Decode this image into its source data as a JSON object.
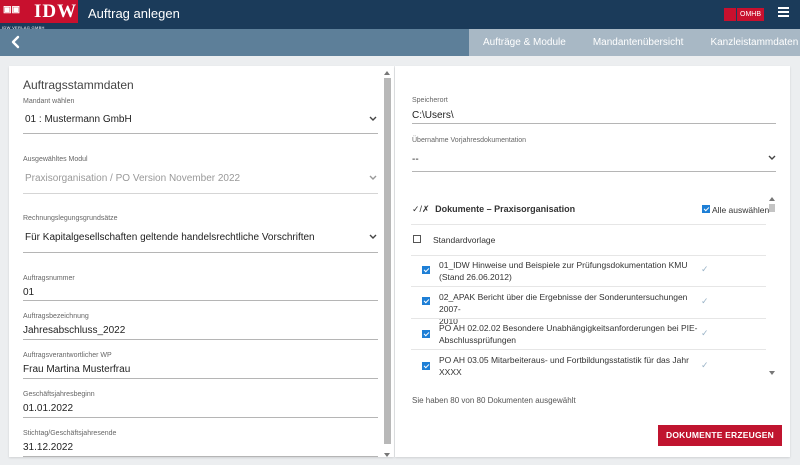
{
  "app": {
    "logo_text": "IDW",
    "logo_sub": "IDW VERLAG GMBH",
    "title": "Auftrag anlegen",
    "brand_badge": "OMHB"
  },
  "nav": {
    "tabs": [
      {
        "label": "Aufträge & Module"
      },
      {
        "label": "Mandantenübersicht"
      },
      {
        "label": "Kanzleistammdaten"
      }
    ]
  },
  "left": {
    "section_title": "Auftragsstammdaten",
    "mandant": {
      "label": "Mandant wählen",
      "value": "01 : Mustermann GmbH"
    },
    "modul": {
      "label": "Ausgewähltes Modul",
      "value": "Praxisorganisation / PO Version November 2022"
    },
    "rechnungslegung": {
      "label": "Rechnungslegungsgrundsätze",
      "value": "Für Kapitalgesellschaften geltende handelsrechtliche Vorschriften"
    },
    "auftragsnummer": {
      "label": "Auftragsnummer",
      "value": "01"
    },
    "auftragsbezeichnung": {
      "label": "Auftragsbezeichnung",
      "value": "Jahresabschluss_2022"
    },
    "wp": {
      "label": "Auftragsverantwortlicher WP",
      "value": "Frau Martina Musterfrau"
    },
    "beginn": {
      "label": "Geschäftsjahresbeginn",
      "value": "01.01.2022"
    },
    "stichtag": {
      "label": "Stichtag/Geschäftsjahresende",
      "value": "31.12.2022"
    }
  },
  "right": {
    "speicherort": {
      "label": "Speicherort",
      "value": "C:\\Users\\"
    },
    "vorjahr": {
      "label": "Übernahme Vorjahresdokumentation",
      "value": "--"
    },
    "docs": {
      "check_col": "✓/✗",
      "header": "Dokumente – Praxisorganisation",
      "select_all": "Alle auswählen",
      "select_all_checked": true,
      "standard": {
        "label": "Standardvorlage",
        "checked": false
      },
      "rows": [
        {
          "line1": "01_IDW Hinweise und Beispiele zur Prüfungsdokumentation KMU",
          "line2": "(Stand 26.06.2012)",
          "checked": true,
          "tick": "✓"
        },
        {
          "line1": "02_APAK Bericht über die Ergebnisse der Sonderuntersuchungen 2007-",
          "line2": "2010",
          "checked": true,
          "tick": "✓"
        },
        {
          "line1": "PO AH 02.02.02 Besondere Unabhängigkeitsanforderungen bei PIE-",
          "line2": "Abschlussprüfungen",
          "checked": true,
          "tick": "✓"
        },
        {
          "line1": "PO AH 03.05 Mitarbeiteraus- und Fortbildungsstatistik für das Jahr",
          "line2": "XXXX",
          "checked": true,
          "tick": "✓"
        }
      ]
    },
    "status": "Sie haben 80 von 80 Dokumenten ausgewählt",
    "button": "DOKUMENTE ERZEUGEN"
  },
  "colors": {
    "header": "#1b3b5a",
    "nav": "#5d7f99",
    "accent": "#c0142f",
    "checkbox": "#1e7fd6"
  },
  "icons": [
    "back-chevron-icon",
    "menu-icon",
    "chevron-down-icon",
    "checkmark-icon"
  ]
}
